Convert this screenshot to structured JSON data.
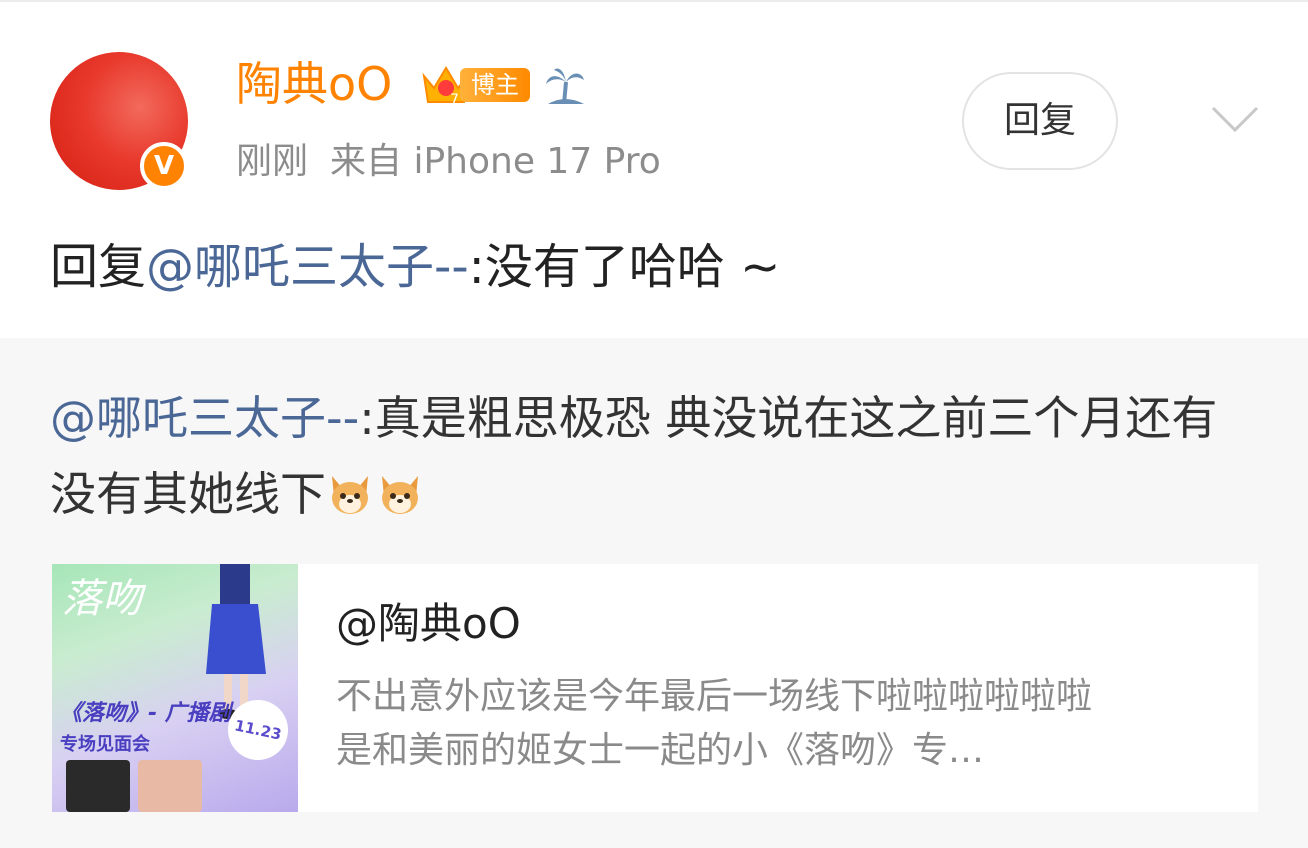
{
  "comment": {
    "author": "陶典oO",
    "author_color": "#ff8200",
    "badge_level": "7",
    "badge_label": "博主",
    "verified_mark": "V",
    "time": "刚刚",
    "source": "来自 iPhone 17 Pro",
    "reply_button": "回复",
    "reply_prefix": "回复",
    "reply_mention": "@哪吒三太子--",
    "reply_body": ":没有了哈哈 ~",
    "mention_color": "#4a6796"
  },
  "quoted": {
    "mention": "@哪吒三太子--",
    "body": ":真是粗思极恐 典没说在这之前三个月还有没有其她线下",
    "emojis": [
      "dog-emoji",
      "dog-emoji"
    ]
  },
  "post_card": {
    "author": "@陶典oO",
    "excerpt_line1": "不出意外应该是今年最后一场线下啦啦啦啦啦啦",
    "excerpt_line2": "是和美丽的姬女士一起的小《落吻》专…",
    "thumb_title": "《落吻》- 广播剧",
    "thumb_subtitle": "专场见面会",
    "thumb_date": "11.23",
    "thumb_brush_text": "落吻"
  }
}
